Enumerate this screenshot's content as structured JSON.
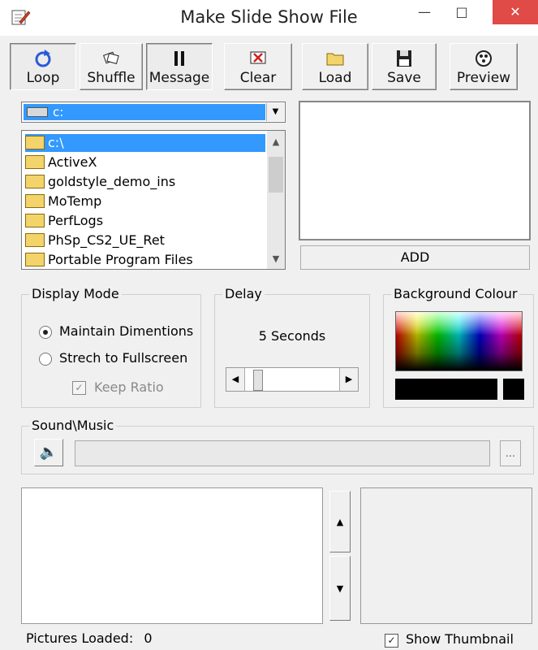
{
  "window": {
    "title": "Make Slide Show File",
    "minimize_icon": "minimize-icon",
    "maximize_icon": "maximize-icon",
    "close_icon": "close-icon"
  },
  "toolbar": {
    "loop": "Loop",
    "shuffle": "Shuffle",
    "message": "Message",
    "clear": "Clear",
    "load": "Load",
    "save": "Save",
    "preview": "Preview"
  },
  "drive": {
    "selected": "c:"
  },
  "folders": [
    "c:\\",
    "ActiveX",
    "goldstyle_demo_ins",
    "MoTemp",
    "PerfLogs",
    "PhSp_CS2_UE_Ret",
    "Portable Program Files"
  ],
  "add_button": "ADD",
  "display_mode": {
    "title": "Display Mode",
    "option1": "Maintain Dimentions",
    "option2": "Strech to Fullscreen",
    "keep_ratio": "Keep Ratio",
    "selected": "Maintain Dimentions"
  },
  "delay": {
    "title": "Delay",
    "value_text": "5 Seconds"
  },
  "background": {
    "title": "Background Colour",
    "colour": "#000000"
  },
  "sound": {
    "title": "Sound\\Music",
    "path": "",
    "browse": "..."
  },
  "status": {
    "pictures_label": "Pictures Loaded:",
    "pictures_count": "0",
    "show_thumbnail": "Show Thumbnail",
    "show_thumbnail_checked": true
  }
}
